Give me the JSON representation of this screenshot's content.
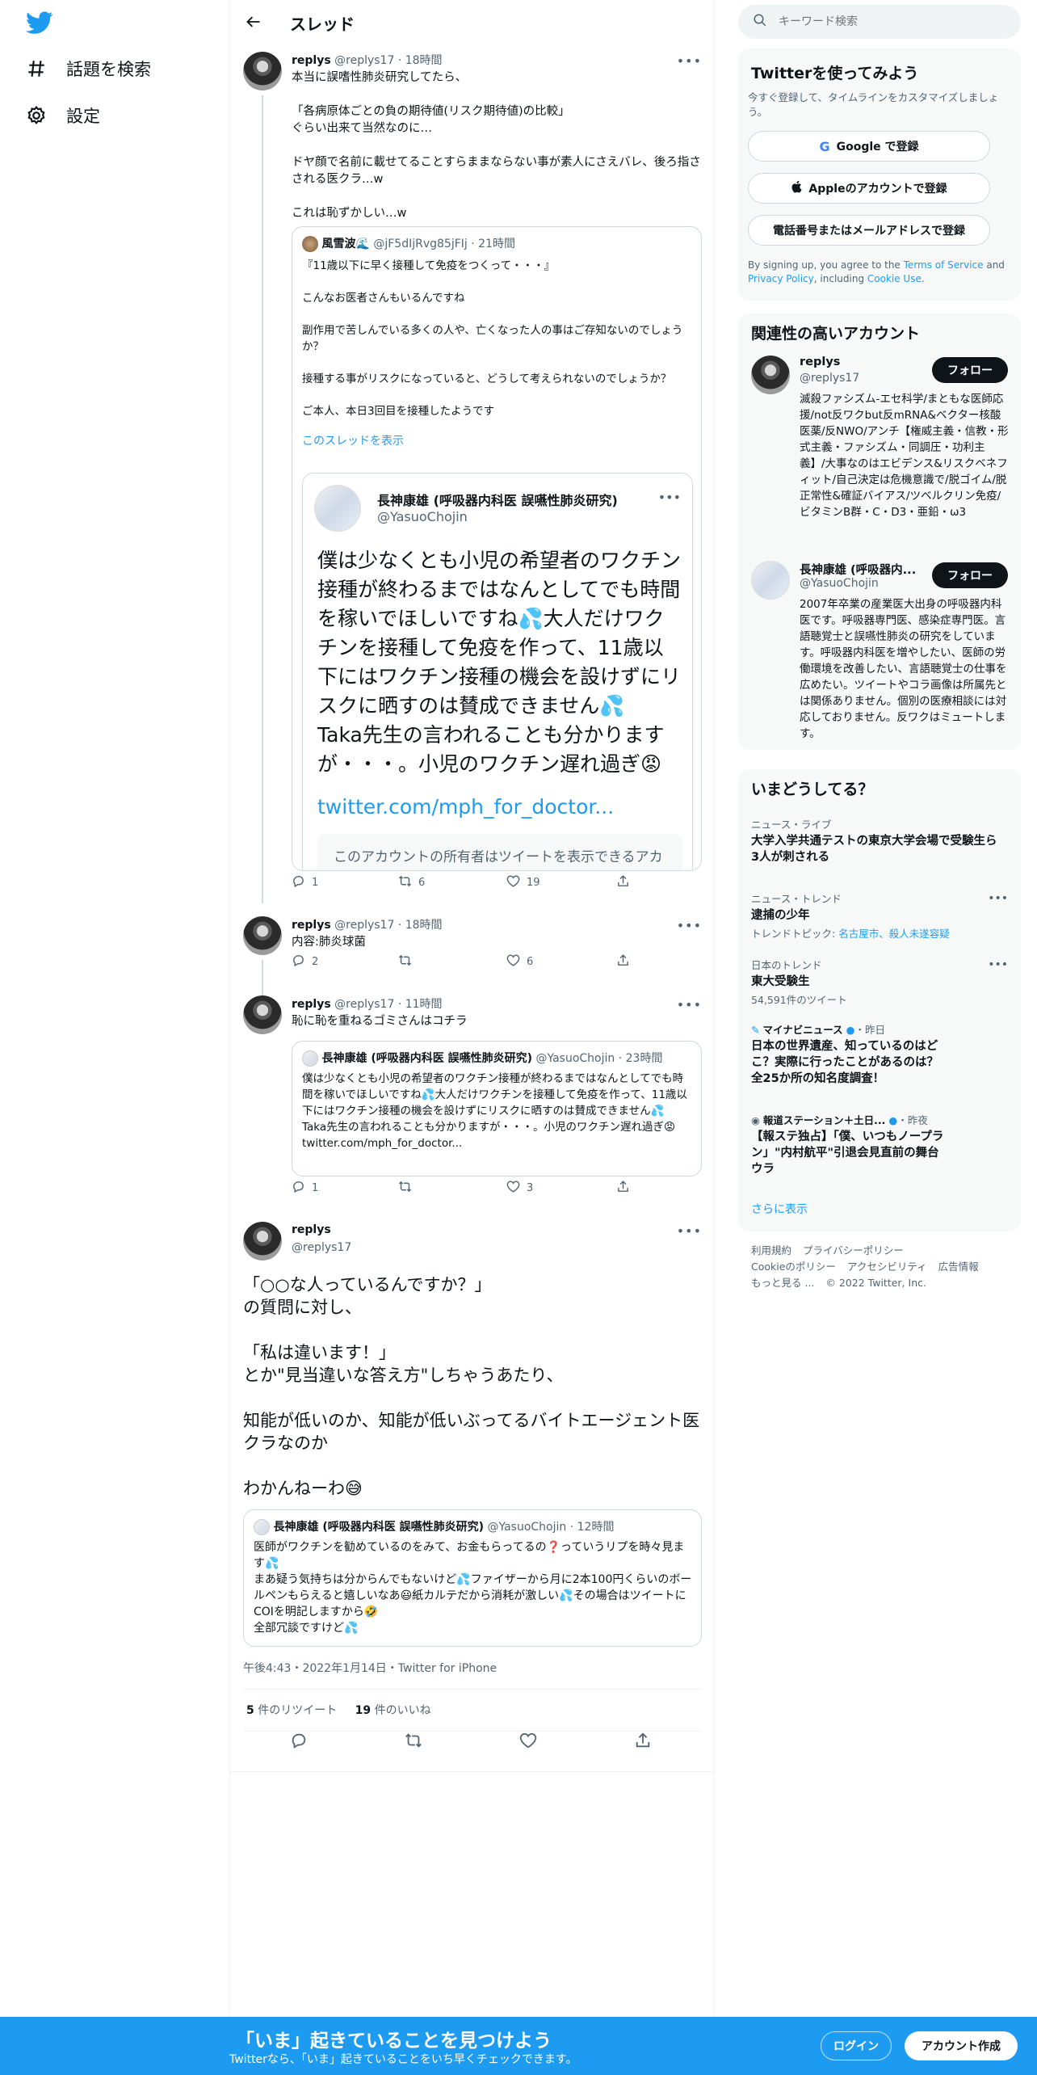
{
  "nav": {
    "explore": "話題を検索",
    "settings": "設定"
  },
  "header": {
    "title": "スレッド"
  },
  "tweets": [
    {
      "name": "replys",
      "handle": "@replys17",
      "time": "18時間",
      "text": "本当に誤嗜性肺炎研究してたら、\n\n「各病原体ごとの負の期待値(リスク期待値)の比較」\nぐらい出来て当然なのに…\n\nドヤ顔で名前に載せてることすらままならない事が素人にさえバレ、後ろ指さされる医クラ…w\n\nこれは恥ずかしい…w",
      "quote": {
        "name": "風雪波🌊",
        "handle": "@jF5dIjRvg85jFIj",
        "time": "21時間",
        "text": "『11歳以下に早く接種して免疫をつくって・・・』\n\nこんなお医者さんもいるんですね\n\n副作用で苦しんでいる多くの人や、亡くなった人の事はご存知ないのでしょうか？\n\n接種する事がリスクになっていると、どうして考えられないのでしょうか？\n\nご本人、本日3回目を接種したようです",
        "show_thread": "このスレッドを表示",
        "embed": {
          "name": "長神康雄 (呼吸器内科医 誤嚥性肺炎研究)",
          "handle": "@YasuoChojin",
          "text": "僕は少なくとも小児の希望者のワクチン接種が終わるまではなんとしてでも時間を稼いでほしいですね💦大人だけワクチンを接種して免疫を作って、11歳以下にはワクチン接種の機会を設けずにリスクに晒すのは賛成できません💦\nTaka先生の言われることも分かりますが・・・。小児のワクチン遅れ過ぎ😡",
          "link": "twitter.com/mph_for_doctor...",
          "cut_text": "このアカウントの所有者はツイートを表示できるアカ"
        }
      },
      "replies": "1",
      "retweets": "6",
      "likes": "19"
    },
    {
      "name": "replys",
      "handle": "@replys17",
      "time": "18時間",
      "text": "内容:肺炎球菌",
      "replies": "2",
      "retweets": "",
      "likes": "6"
    },
    {
      "name": "replys",
      "handle": "@replys17",
      "time": "11時間",
      "text": "恥に恥を重ねるゴミさんはコチラ",
      "quote": {
        "name": "長神康雄 (呼吸器内科医 誤嚥性肺炎研究)",
        "handle": "@YasuoChojin",
        "time": "23時間",
        "text": "僕は少なくとも小児の希望者のワクチン接種が終わるまではなんとしてでも時間を稼いでほしいですね💦大人だけワクチンを接種して免疫を作って、11歳以下にはワクチン接種の機会を設けずにリスクに晒すのは賛成できません💦\nTaka先生の言われることも分かりますが・・・。小児のワクチン遅れ過ぎ😡 twitter.com/mph_for_doctor..."
      },
      "replies": "1",
      "retweets": "",
      "likes": "3"
    }
  ],
  "main_tweet": {
    "name": "replys",
    "handle": "@replys17",
    "text": "「○○な人っているんですか？」\nの質問に対し、\n\n「私は違います！」\nとか\"見当違いな答え方\"しちゃうあたり、\n\n知能が低いのか、知能が低いぶってるバイトエージェント医クラなのか\n\nわかんねーわ😅",
    "quote": {
      "name": "長神康雄 (呼吸器内科医 誤嚥性肺炎研究)",
      "handle": "@YasuoChojin",
      "time": "12時間",
      "text": "医師がワクチンを勧めているのをみて、お金もらってるの❓っていうリプを時々見ます💦\nまあ疑う気持ちは分からんでもないけど💦ファイザーから月に2本100円くらいのボールペンもらえると嬉しいなあ😃紙カルテだから消耗が激しい💦その場合はツイートにCOIを明記しますから🤣\n全部冗談ですけど💦"
    },
    "timestamp": "午後4:43・2022年1月14日・Twitter for iPhone",
    "retweet_count": "5",
    "retweet_label": "件のリツイート",
    "like_count": "19",
    "like_label": "件のいいね"
  },
  "right": {
    "search_placeholder": "キーワード検索",
    "signup_card": {
      "title": "Twitterを使ってみよう",
      "desc": "今すぐ登録して、タイムラインをカスタマイズしましょう。",
      "google": "Google で登録",
      "apple": "Appleのアカウントで登録",
      "phone": "電話番号またはメールアドレスで登録",
      "terms_pre": "By signing up, you agree to the ",
      "terms": "Terms of Service",
      "terms_and": " and ",
      "privacy": "Privacy Policy",
      "terms_inc": ", including ",
      "cookie": "Cookie Use",
      "terms_end": "."
    },
    "relevant": {
      "title": "関連性の高いアカウント",
      "follow": "フォロー",
      "accounts": [
        {
          "name": "replys",
          "handle": "@replys17",
          "bio": "滅殺ファシズム-エセ科学/まともな医師応援/not反ワクbut反mRNA&ベクター核酸医薬/反NWO/アンチ【権威主義・信教・形式主義・ファシズム・同調圧・功利主義】/大事なのはエビデンス&リスクベネフィット/自己決定は危機意識で/脱ゴイム/脱正常性&確証バイアス/ツベルクリン免疫/ビタミンB群・C・D3・亜鉛・ω3"
        },
        {
          "name": "長神康雄 (呼吸器内...",
          "handle": "@YasuoChojin",
          "bio": "2007年卒業の産業医大出身の呼吸器内科医です。呼吸器専門医、感染症専門医。言語聴覚士と誤嚥性肺炎の研究をしています。呼吸器内科医を増やしたい、医師の労働環境を改善したい、言語聴覚士の仕事を広めたい。ツイートやコラ画像は所属先とは関係ありません。個別の医療相談には対応しておりません。反ワクはミュートします。"
        }
      ]
    },
    "trends": {
      "title": "いまどうしてる？",
      "items": [
        {
          "meta": "ニュース・ライブ",
          "name": "大学入学共通テストの東京大学会場で受験生ら3人が刺される"
        },
        {
          "meta": "ニュース・トレンド",
          "name": "逮捕の少年",
          "sub_label": "トレンドトピック: ",
          "sub_links": "名古屋市、殺人未遂容疑"
        },
        {
          "meta": "日本のトレンド",
          "name": "東大受験生",
          "sub": "54,591件のツイート"
        },
        {
          "meta_source": "マイナビニュース",
          "meta_time": "・昨日",
          "name": "日本の世界遺産、知っているのはどこ？実際に行ったことがあるのは？全25か所の知名度調査！"
        },
        {
          "meta_source": "報道ステーション＋土日...",
          "meta_time": "・昨夜",
          "name": "【報ステ独占】「僕、いつもノープラン」\"内村航平\"引退会見直前の舞台ウラ"
        }
      ],
      "more": "さらに表示"
    },
    "footer": {
      "links1": [
        "利用規約",
        "プライバシーポリシー"
      ],
      "links2": [
        "Cookieのポリシー",
        "アクセシビリティ",
        "広告情報"
      ],
      "more": "もっと見る ...",
      "copyright": "© 2022 Twitter, Inc."
    }
  },
  "bottom": {
    "title": "「いま」起きていることを見つけよう",
    "sub": "Twitterなら、「いま」起きていることをいち早くチェックできます。",
    "login": "ログイン",
    "signup": "アカウント作成"
  },
  "colors": {
    "accent": "#1d9bf0",
    "text": "#0f1419",
    "muted": "#536471"
  }
}
